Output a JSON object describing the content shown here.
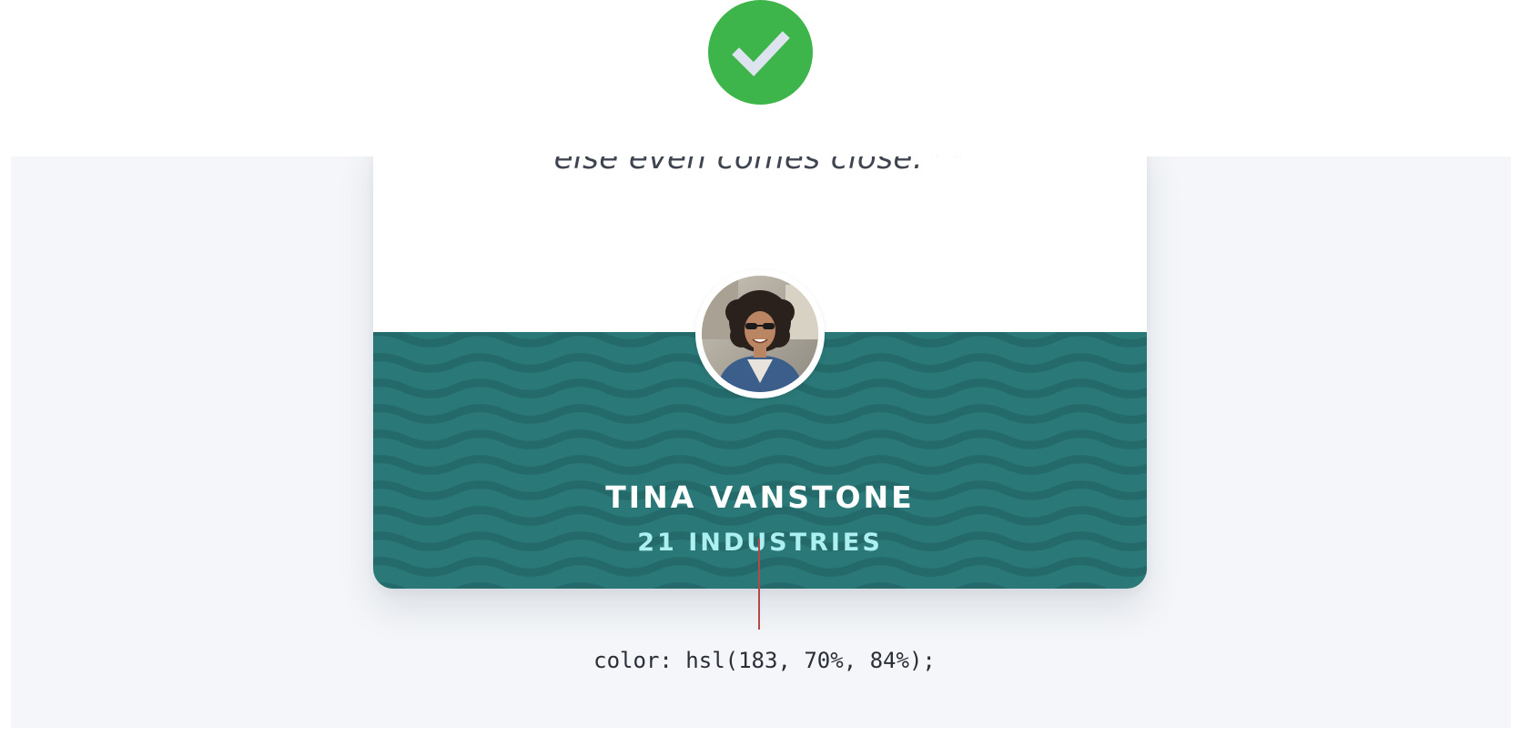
{
  "badge": {
    "icon": "checkmark-icon",
    "color": "#3db54a"
  },
  "card": {
    "quote_text": "else even comes close.",
    "quote_mark": "” ”",
    "accent_color": "#2b7878",
    "person_name": "TINA VANSTONE",
    "company": "21 INDUSTRIES",
    "company_color": "#adf0f2",
    "avatar_alt": "avatar photo"
  },
  "annotation": {
    "label": "color: hsl(183, 70%, 84%);"
  }
}
